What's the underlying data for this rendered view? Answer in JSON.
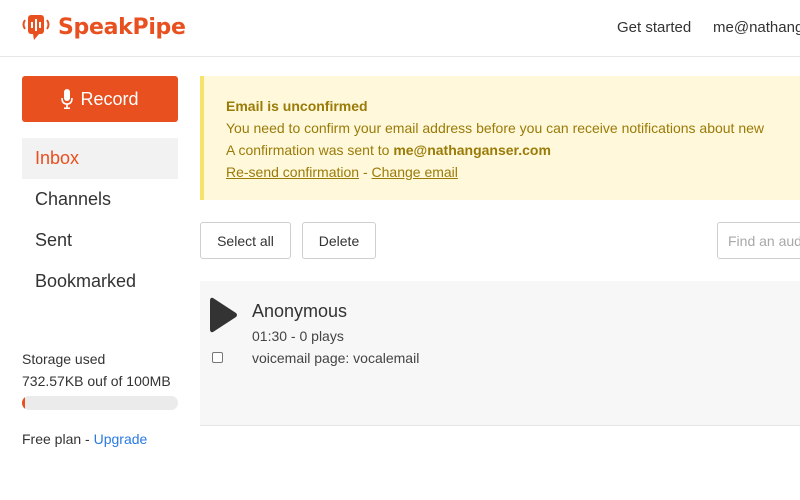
{
  "header": {
    "brand": "SpeakPipe",
    "nav": {
      "get_started": "Get started",
      "user_email": "me@nathang"
    }
  },
  "sidebar": {
    "record_label": "Record",
    "items": [
      {
        "label": "Inbox",
        "active": true
      },
      {
        "label": "Channels"
      },
      {
        "label": "Sent"
      },
      {
        "label": "Bookmarked"
      }
    ],
    "storage": {
      "label": "Storage used",
      "value_text": "732.57KB ouf of 100MB",
      "used_fraction": 0.007
    },
    "plan": {
      "text": "Free plan - ",
      "upgrade": "Upgrade"
    }
  },
  "alert": {
    "title": "Email is unconfirmed",
    "line1": "You need to confirm your email address before you can receive notifications about new",
    "line2_prefix": "A confirmation was sent to ",
    "email": "me@nathanganser.com",
    "resend": "Re-send confirmation",
    "separator": " - ",
    "change": "Change email"
  },
  "toolbar": {
    "select_all": "Select all",
    "delete": "Delete",
    "search_placeholder": "Find an audio"
  },
  "messages": [
    {
      "name": "Anonymous",
      "meta": "01:30 - 0 plays",
      "source": "voicemail page: vocalemail"
    }
  ],
  "colors": {
    "accent": "#e8501f",
    "alert_bg": "#fff8db",
    "alert_text": "#9a7b08",
    "link": "#2a7ae2"
  }
}
